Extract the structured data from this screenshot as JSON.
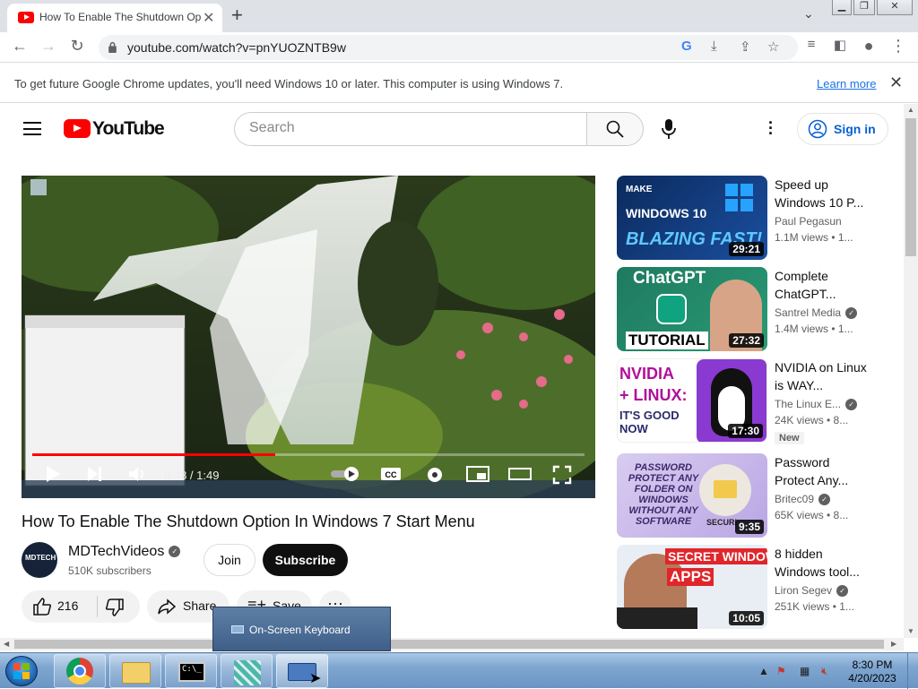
{
  "browser": {
    "tab_title": "How To Enable The Shutdown Op",
    "url": "youtube.com/watch?v=pnYUOZNTB9w",
    "infobar_message": "To get future Google Chrome updates, you'll need Windows 10 or later. This computer is using Windows 7.",
    "infobar_link": "Learn more"
  },
  "youtube": {
    "logo_text": "YouTube",
    "search_placeholder": "Search",
    "signin_label": "Sign in"
  },
  "player": {
    "time": "0:48 / 1:49",
    "progress": 0.44
  },
  "video": {
    "title": "How To Enable The Shutdown Option In Windows 7 Start Menu",
    "channel": "MDTechVideos",
    "avatar_text": "MDTECH",
    "subscribers": "510K subscribers",
    "join_label": "Join",
    "subscribe_label": "Subscribe",
    "likes": "216",
    "share_label": "Share",
    "save_label": "Save"
  },
  "recommendations": [
    {
      "title": "Speed up Windows 10 P...",
      "channel": "Paul Pegasun",
      "meta": "1.1M views  • 1...",
      "duration": "29:21",
      "thumb_text_1": "MAKE",
      "thumb_text_2": "WINDOWS 10",
      "thumb_text_3": "BLAZING FAST!"
    },
    {
      "title": "Complete ChatGPT...",
      "channel": "Santrel Media",
      "meta": "1.4M views  • 1...",
      "duration": "27:32",
      "thumb_text_1": "ChatGPT",
      "thumb_text_2": "TUTORIAL"
    },
    {
      "title": "NVIDIA on Linux is WAY...",
      "channel": "The Linux E...",
      "meta": "24K views  • 8...",
      "duration": "17:30",
      "badge": "New",
      "thumb_text_1": "NVIDIA",
      "thumb_text_2": "+ LINUX:",
      "thumb_text_3": "IT'S GOOD NOW"
    },
    {
      "title": "Password Protect Any...",
      "channel": "Britec09",
      "meta": "65K views  • 8...",
      "duration": "9:35",
      "thumb_text_1": "PASSWORD PROTECT ANY FOLDER ON WINDOWS WITHOUT ANY SOFTWARE",
      "thumb_text_2": "SECURI"
    },
    {
      "title": "8 hidden Windows tool...",
      "channel": "Liron Segev",
      "meta": "251K views  • 1...",
      "duration": "10:05",
      "thumb_text_1": "SECRET WINDOWS",
      "thumb_text_2": "APPS"
    }
  ],
  "osk_popup": {
    "label": "On-Screen Keyboard"
  },
  "taskbar": {
    "time": "8:30 PM",
    "date": "4/20/2023"
  },
  "colors": {
    "youtube_red": "#ff0000",
    "link_blue": "#065fd4",
    "taskbar": "#7ea6d0"
  }
}
